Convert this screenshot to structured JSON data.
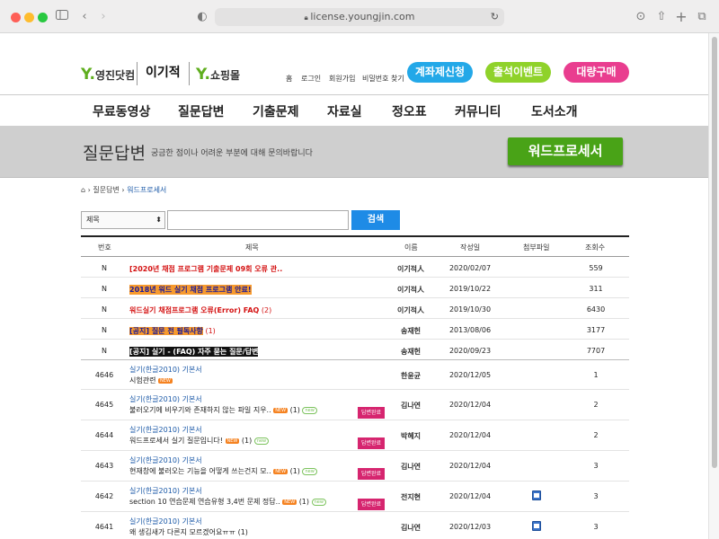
{
  "browser": {
    "url": "license.youngjin.com"
  },
  "header": {
    "logo_youngjin": "영진닷컴",
    "logo_igijeok": "이기적",
    "logo_shop": "쇼핑몰",
    "util_links": [
      "홈",
      "로그인",
      "회원가입",
      "비밀번호 찾기"
    ],
    "pills": [
      "계좌제신청",
      "출석이벤트",
      "대량구매"
    ],
    "colors": {
      "pill1": "#23a8e8",
      "pill2": "#8fd22a",
      "pill3": "#e93d8f"
    }
  },
  "nav": [
    "무료동영상",
    "질문답변",
    "기출문제",
    "자료실",
    "정오표",
    "커뮤니티",
    "도서소개"
  ],
  "banner": {
    "title": "질문답변",
    "subtitle": "궁금한 점이나 어려운 부분에 대해 문의바랍니다",
    "button": "워드프로세서"
  },
  "breadcrumb": [
    "질문답변",
    "워드프로세서"
  ],
  "search": {
    "select": "제목",
    "button": "검색"
  },
  "columns": [
    "번호",
    "제목",
    "이름",
    "작성일",
    "첨부파일",
    "조회수"
  ],
  "notices": [
    {
      "num": "N",
      "title": "[2020년 채점 프로그램 기출문제 09회 오류 관..",
      "count": "",
      "name": "이기적人",
      "date": "2020/02/07",
      "views": "559",
      "style": "red"
    },
    {
      "num": "N",
      "title": "2018년 워드 실기 채점 프로그램 안료!",
      "count": "",
      "name": "이기적人",
      "date": "2019/10/22",
      "views": "311",
      "style": "hlo"
    },
    {
      "num": "N",
      "title": "워드실기 채점프로그램 오류(Error) FAQ",
      "count": "(2)",
      "name": "이기적人",
      "date": "2019/10/30",
      "views": "6430",
      "style": "red"
    },
    {
      "num": "N",
      "title": "[공지] 질문 전 필독사항",
      "count": "(1)",
      "name": "송재헌",
      "date": "2013/08/06",
      "views": "3177",
      "style": "hlo"
    },
    {
      "num": "N",
      "title": "[공지] 실기 - (FAQ) 자주 묻는 질문/답변",
      "count": "",
      "name": "송재헌",
      "date": "2020/09/23",
      "views": "7707",
      "style": "hlb"
    }
  ],
  "posts": [
    {
      "num": "4646",
      "category": "실기(한글2010) 기본서",
      "title": "시험관련",
      "badge": "NEW",
      "count": "",
      "new2": "",
      "done": "",
      "file": false,
      "name": "한윤균",
      "date": "2020/12/05",
      "views": "1"
    },
    {
      "num": "4645",
      "category": "실기(한글2010) 기본서",
      "title": "불러오기에 비우기와 존재하지 않는 파일 지우..",
      "badge": "NEW",
      "count": "(1)",
      "new2": "new",
      "done": "답변완료",
      "file": false,
      "name": "김나연",
      "date": "2020/12/04",
      "views": "2"
    },
    {
      "num": "4644",
      "category": "실기(한글2010) 기본서",
      "title": "워드프로세서 실기 질문입니다!",
      "badge": "NEW",
      "count": "(1)",
      "new2": "new",
      "done": "답변완료",
      "file": false,
      "name": "박혜지",
      "date": "2020/12/04",
      "views": "2"
    },
    {
      "num": "4643",
      "category": "실기(한글2010) 기본서",
      "title": "현재창에 불러오는 기능을 어떻게 쓰는건지 모..",
      "badge": "NEW",
      "count": "(1)",
      "new2": "new",
      "done": "답변완료",
      "file": false,
      "name": "김나연",
      "date": "2020/12/04",
      "views": "3"
    },
    {
      "num": "4642",
      "category": "실기(한글2010) 기본서",
      "title": "section 10 연습문제 연습유형 3,4번 문제 정답..",
      "badge": "NEW",
      "count": "(1)",
      "new2": "new",
      "done": "답변완료",
      "file": true,
      "name": "전지현",
      "date": "2020/12/04",
      "views": "3"
    },
    {
      "num": "4641",
      "category": "실기(한글2010) 기본서",
      "title": "왜 생김새가 다른지 모르겠어요ㅠㅠ",
      "badge": "",
      "count": "(1)",
      "new2": "",
      "done": "",
      "file": true,
      "name": "김나연",
      "date": "2020/12/03",
      "views": "3"
    }
  ]
}
